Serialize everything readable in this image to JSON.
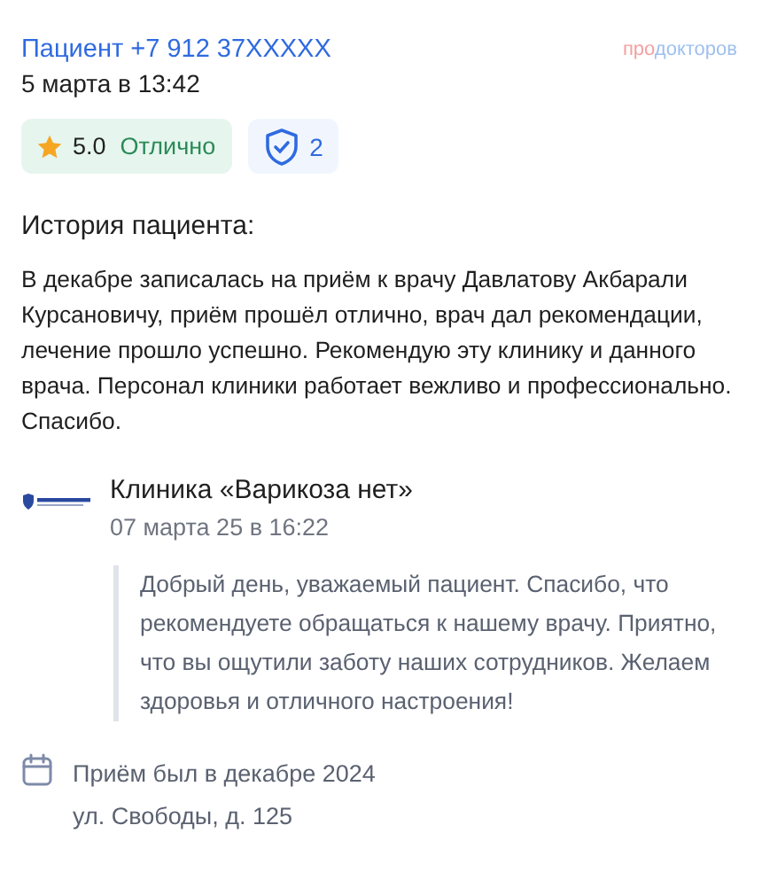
{
  "author": "Пациент +7 912 37XXXXX",
  "brand": {
    "prefix": "про",
    "rest": "докторов"
  },
  "date": "5 марта в 13:42",
  "rating": {
    "score": "5.0",
    "label": "Отлично"
  },
  "verified": {
    "count": "2"
  },
  "history_title": "История пациента:",
  "review": "В декабре записалась на приём к врачу Давлатову Акбарали Курсановичу, приём прошёл отлично, врач дал рекомендации, лечение прошло успешно. Рекомендую эту клинику и данного врача. Персонал клиники работает вежливо и профессионально. Спасибо.",
  "reply": {
    "clinic": "Клиника «Варикоза нет»",
    "date": "07 марта 25 в 16:22",
    "text": "Добрый день, уважаемый пациент. Спасибо, что рекомендуете обращаться к нашему врачу. Приятно, что вы ощутили заботу наших сотрудников. Желаем здоровья и отличного настроения!"
  },
  "visit": {
    "when": "Приём был в декабре 2024",
    "address": "ул. Свободы, д. 125"
  }
}
